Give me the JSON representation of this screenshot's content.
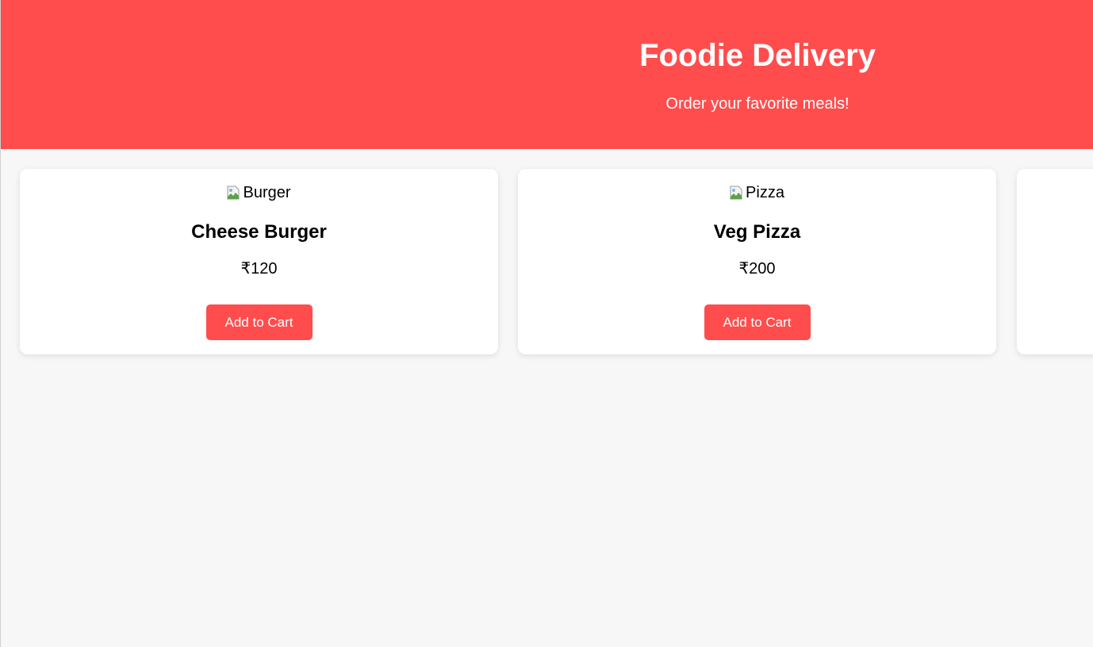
{
  "header": {
    "title": "Foodie Delivery",
    "subtitle": "Order your favorite meals!"
  },
  "menu": {
    "items": [
      {
        "image_alt": "Burger",
        "name": "Cheese Burger",
        "price": "₹120",
        "button_label": "Add to Cart"
      },
      {
        "image_alt": "Pizza",
        "name": "Veg Pizza",
        "price": "₹200",
        "button_label": "Add to Cart"
      }
    ]
  },
  "colors": {
    "brand": "#ff4d4d",
    "card_background": "#ffffff",
    "page_background": "#f7f7f7"
  }
}
